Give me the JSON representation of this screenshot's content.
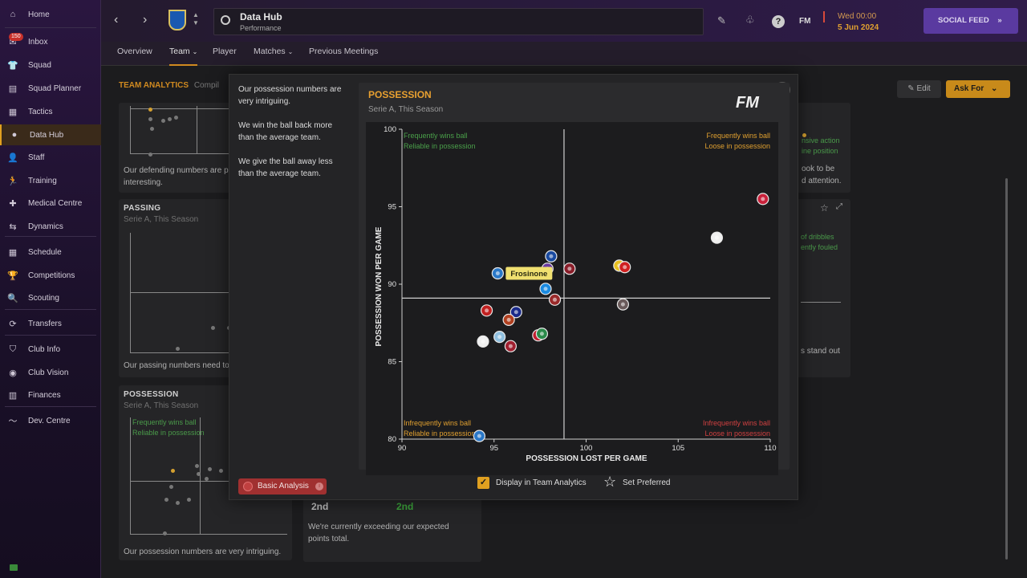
{
  "sidebar": {
    "items": [
      {
        "label": "Home",
        "icon": "home-icon",
        "glyph": "⌂"
      },
      {
        "label": "Inbox",
        "icon": "inbox-icon",
        "glyph": "✉",
        "badge": "150"
      },
      {
        "label": "Squad",
        "icon": "shirt-icon",
        "glyph": "👕"
      },
      {
        "label": "Squad Planner",
        "icon": "clipboard-icon",
        "glyph": "▤"
      },
      {
        "label": "Tactics",
        "icon": "tactics-icon",
        "glyph": "▦"
      },
      {
        "label": "Data Hub",
        "icon": "data-hub-icon",
        "glyph": "●"
      },
      {
        "label": "Staff",
        "icon": "staff-icon",
        "glyph": "👤"
      },
      {
        "label": "Training",
        "icon": "training-icon",
        "glyph": "🏃"
      },
      {
        "label": "Medical Centre",
        "icon": "medical-icon",
        "glyph": "✚"
      },
      {
        "label": "Dynamics",
        "icon": "dynamics-icon",
        "glyph": "⇆"
      },
      {
        "label": "Schedule",
        "icon": "calendar-icon",
        "glyph": "▦"
      },
      {
        "label": "Competitions",
        "icon": "trophy-icon",
        "glyph": "🏆"
      },
      {
        "label": "Scouting",
        "icon": "search-icon",
        "glyph": "🔍"
      },
      {
        "label": "Transfers",
        "icon": "transfers-icon",
        "glyph": "⟳"
      },
      {
        "label": "Club Info",
        "icon": "shield-icon",
        "glyph": "⛉"
      },
      {
        "label": "Club Vision",
        "icon": "vision-icon",
        "glyph": "◉"
      },
      {
        "label": "Finances",
        "icon": "finances-icon",
        "glyph": "▥"
      },
      {
        "label": "Dev. Centre",
        "icon": "dev-centre-icon",
        "glyph": "〜"
      }
    ]
  },
  "topbar": {
    "title": "Data Hub",
    "subtitle": "Performance",
    "date_time": "Wed 00:00",
    "date": "5 Jun 2024",
    "social_feed": "SOCIAL FEED",
    "fm_label": "FM"
  },
  "subnav": {
    "tabs": [
      "Overview",
      "Team",
      "Player",
      "Matches",
      "Previous Meetings"
    ]
  },
  "content": {
    "team_analytics_label": "TEAM ANALYTICS",
    "team_analytics_suffix": "Compil",
    "edit_label": "Edit",
    "ask_for_label": "Ask For",
    "defending_text": "Our defending numbers are p",
    "defending_text2": "interesting.",
    "passing_title": "PASSING",
    "passing_sub": "Serie A, This Season",
    "passing_text": "Our passing numbers need to",
    "possession_title": "POSSESSION",
    "possession_sub": "Serie A, This Season",
    "possession_q1": "Frequently wins ball",
    "possession_q2": "Reliable in possession",
    "possession_text": "Our possession numbers are very intriguing.",
    "right_card_text1": "nsive action",
    "right_card_text2": "ine position",
    "right_card_text3": "ook to be",
    "right_card_text4": "d attention.",
    "right_card2_text1": "of dribbles",
    "right_card2_text2": "ently fouled",
    "right_card2_text3": "s stand out",
    "league_pos_actual": "2nd",
    "league_pos_expected": "2nd",
    "league_text": "We're currently exceeding our expected points total."
  },
  "modal": {
    "paragraphs": [
      "Our possession numbers are very intriguing.",
      "We win the ball back more than the average team.",
      "We give the ball away less than the average team."
    ],
    "basic_analysis_label": "Basic Analysis",
    "display_label": "Display in Team Analytics",
    "set_preferred_label": "Set Preferred",
    "fm_logo": "FM"
  },
  "chart_data": {
    "type": "scatter",
    "title": "POSSESSION",
    "subtitle": "Serie A, This Season",
    "xlabel": "POSSESSION LOST PER GAME",
    "ylabel": "POSSESSION WON PER GAME",
    "xlim": [
      90,
      110
    ],
    "ylim": [
      80,
      100
    ],
    "xticks": [
      90,
      95,
      100,
      105,
      110
    ],
    "yticks": [
      80,
      85,
      90,
      95,
      100
    ],
    "average_x": 98.8,
    "average_y": 89.1,
    "quadrants": {
      "top_left": [
        "Frequently wins ball",
        "Reliable in possession"
      ],
      "top_right": [
        "Frequently wins ball",
        "Loose in possession"
      ],
      "bottom_left": [
        "Infrequently wins ball",
        "Reliable in possession"
      ],
      "bottom_right": [
        "Infrequently wins ball",
        "Loose in possession"
      ]
    },
    "highlight_label": "Frosinone",
    "points": [
      {
        "x": 109.6,
        "y": 95.5,
        "color": "#c8203a"
      },
      {
        "x": 107.1,
        "y": 93.0,
        "color": "#f0f0f0"
      },
      {
        "x": 101.8,
        "y": 91.2,
        "color": "#e8c020"
      },
      {
        "x": 102.1,
        "y": 91.1,
        "color": "#d02020"
      },
      {
        "x": 99.1,
        "y": 91.0,
        "color": "#8a1e2a"
      },
      {
        "x": 98.1,
        "y": 91.8,
        "color": "#1a4aa0"
      },
      {
        "x": 97.9,
        "y": 91.0,
        "color": "#6a3aa0"
      },
      {
        "x": 95.2,
        "y": 90.7,
        "color": "#2a78c8"
      },
      {
        "x": 97.8,
        "y": 89.7,
        "color": "#1a8ae0"
      },
      {
        "x": 98.3,
        "y": 89.0,
        "color": "#9a2a2a"
      },
      {
        "x": 102.0,
        "y": 88.7,
        "color": "#6a5a5a"
      },
      {
        "x": 94.6,
        "y": 88.3,
        "color": "#c02020"
      },
      {
        "x": 96.2,
        "y": 88.2,
        "color": "#1a2a8a"
      },
      {
        "x": 95.8,
        "y": 87.7,
        "color": "#b04020"
      },
      {
        "x": 97.4,
        "y": 86.7,
        "color": "#c02030"
      },
      {
        "x": 97.6,
        "y": 86.8,
        "color": "#2a8a4a"
      },
      {
        "x": 94.4,
        "y": 86.3,
        "color": "#f0f0f0"
      },
      {
        "x": 95.3,
        "y": 86.6,
        "color": "#90c0e0"
      },
      {
        "x": 95.9,
        "y": 86.0,
        "color": "#a02030"
      },
      {
        "x": 94.2,
        "y": 80.2,
        "color": "#2a78c8"
      }
    ],
    "highlight_point": {
      "x": 95.2,
      "y": 90.7
    }
  }
}
